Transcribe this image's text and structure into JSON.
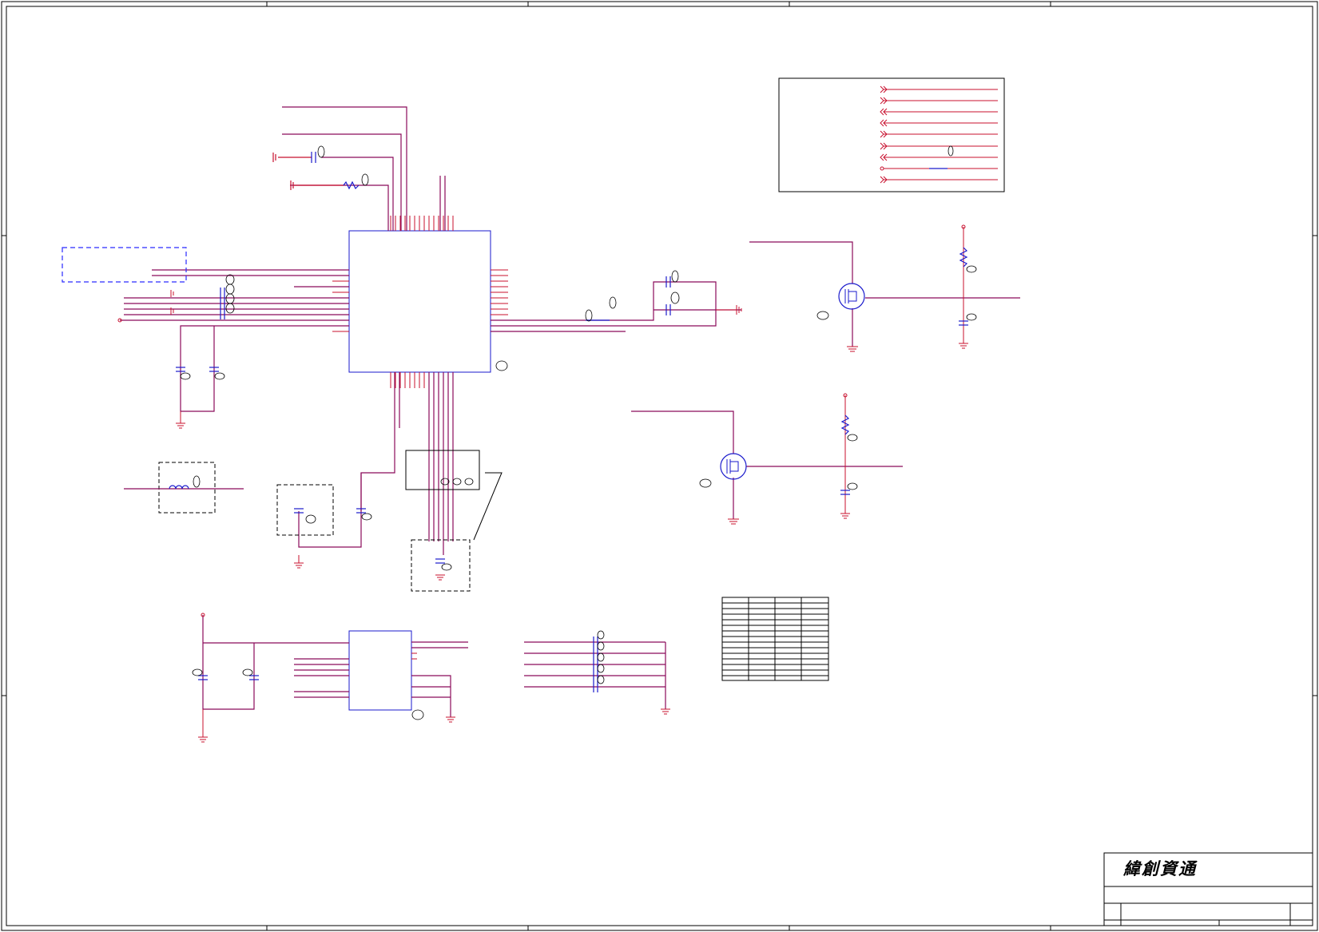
{
  "title_block": {
    "company_logo": "緯創資通"
  },
  "colors": {
    "wire": "#c8102e",
    "net": "#8b0a5a",
    "component": "#1a1acc",
    "border": "#000000",
    "dashed_box": "#2a2aff"
  }
}
